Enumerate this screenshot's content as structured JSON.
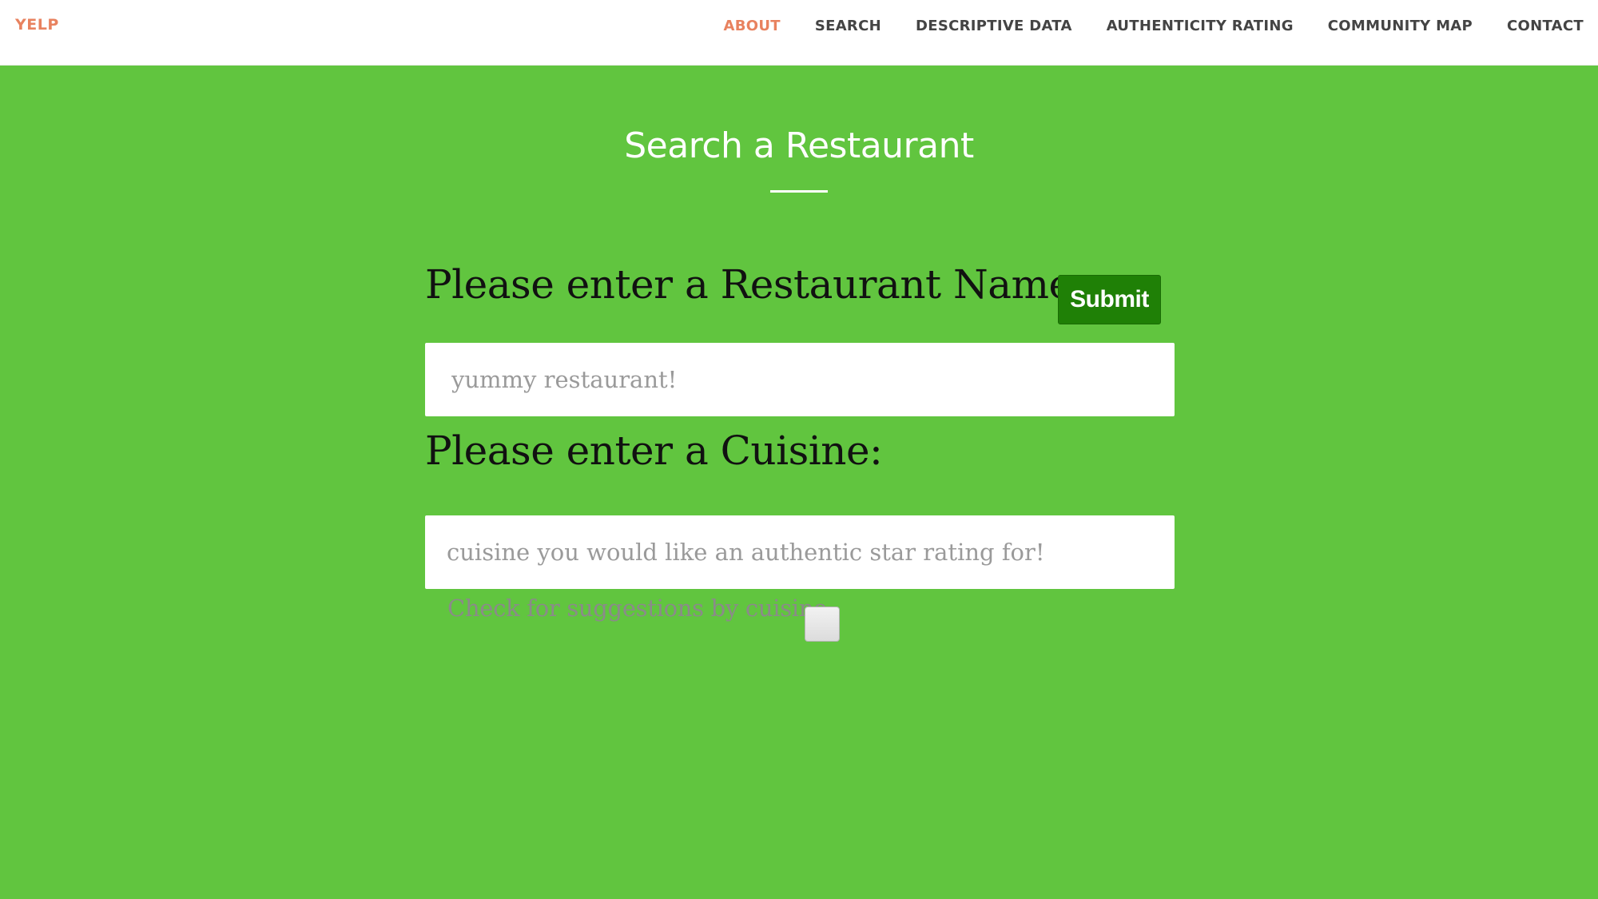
{
  "header": {
    "brand": "YELP",
    "nav": [
      {
        "label": "ABOUT",
        "active": true
      },
      {
        "label": "SEARCH",
        "active": false
      },
      {
        "label": "DESCRIPTIVE DATA",
        "active": false
      },
      {
        "label": "AUTHENTICITY RATING",
        "active": false
      },
      {
        "label": "COMMUNITY MAP",
        "active": false
      },
      {
        "label": "CONTACT",
        "active": false
      }
    ]
  },
  "search": {
    "title": "Search a Restaurant",
    "name_label": "Please enter a Restaurant Name:",
    "submit_label": "Submit",
    "name_placeholder": "yummy restaurant!",
    "cuisine_label": "Please enter a Cuisine:",
    "cuisine_placeholder": "cuisine you would like an authentic star rating for!",
    "suggest_label": "Check for suggestions by cuisine",
    "suggest_checked": false
  },
  "colors": {
    "accent": "#e8825f",
    "nav_text": "#444444",
    "background": "#61c53f",
    "submit": "#1f8006"
  }
}
